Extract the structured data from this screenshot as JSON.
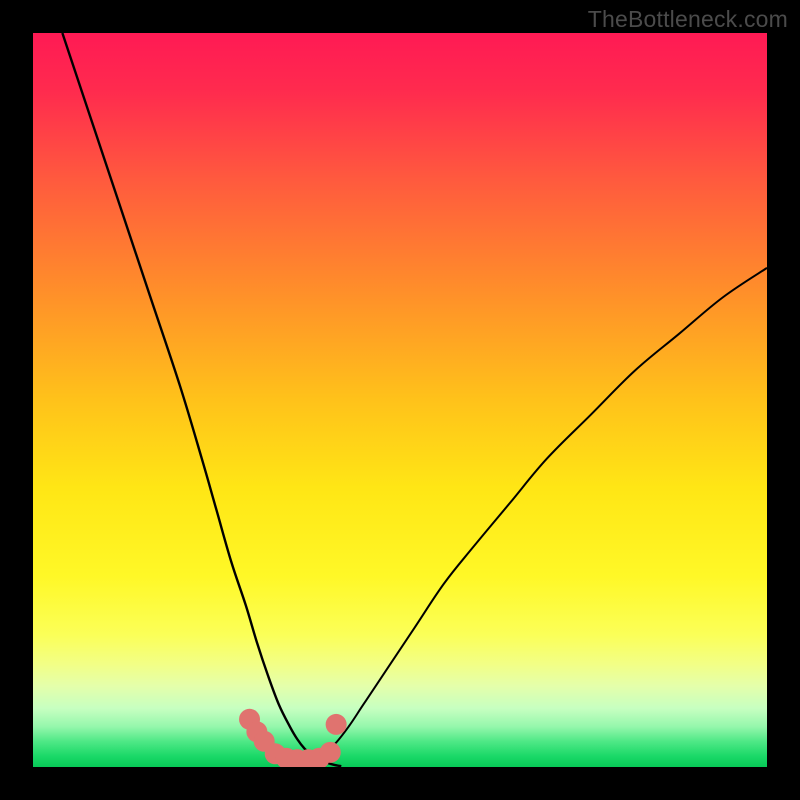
{
  "watermark": "TheBottleneck.com",
  "chart_data": {
    "type": "line",
    "title": "",
    "xlabel": "",
    "ylabel": "",
    "xlim": [
      0,
      100
    ],
    "ylim": [
      0,
      100
    ],
    "series": [
      {
        "name": "left-curve",
        "x": [
          4,
          8,
          12,
          16,
          20,
          23,
          25,
          27,
          29,
          30.5,
          32,
          33.5,
          35,
          36,
          37,
          38,
          39,
          40,
          41,
          42
        ],
        "y": [
          100,
          88,
          76,
          64,
          52,
          42,
          35,
          28,
          22,
          17,
          12.5,
          8.5,
          5.5,
          3.8,
          2.5,
          1.6,
          1.0,
          0.6,
          0.3,
          0.1
        ]
      },
      {
        "name": "right-curve",
        "x": [
          35,
          37,
          39,
          41,
          43,
          45,
          48,
          52,
          56,
          60,
          65,
          70,
          76,
          82,
          88,
          94,
          100
        ],
        "y": [
          0.1,
          0.5,
          1.4,
          3.0,
          5.5,
          8.5,
          13,
          19,
          25,
          30,
          36,
          42,
          48,
          54,
          59,
          64,
          68
        ]
      },
      {
        "name": "marker-cluster",
        "x": [
          29.5,
          30.5,
          31.5,
          33,
          34.5,
          36,
          37.5,
          39,
          40.5,
          41.3
        ],
        "y": [
          6.5,
          4.8,
          3.5,
          1.8,
          1.2,
          1.0,
          1.0,
          1.2,
          2.0,
          5.8
        ]
      }
    ],
    "gradient_stops": [
      {
        "pos": 0.0,
        "color": "#ff1a54"
      },
      {
        "pos": 0.08,
        "color": "#ff2b4e"
      },
      {
        "pos": 0.2,
        "color": "#ff5a3e"
      },
      {
        "pos": 0.35,
        "color": "#ff8e2a"
      },
      {
        "pos": 0.5,
        "color": "#ffc21a"
      },
      {
        "pos": 0.62,
        "color": "#ffe615"
      },
      {
        "pos": 0.74,
        "color": "#fff827"
      },
      {
        "pos": 0.82,
        "color": "#fbff58"
      },
      {
        "pos": 0.86,
        "color": "#f2ff86"
      },
      {
        "pos": 0.89,
        "color": "#e4ffab"
      },
      {
        "pos": 0.92,
        "color": "#c7ffc1"
      },
      {
        "pos": 0.945,
        "color": "#95f7ac"
      },
      {
        "pos": 0.965,
        "color": "#4fe886"
      },
      {
        "pos": 0.985,
        "color": "#1bd968"
      },
      {
        "pos": 1.0,
        "color": "#07c957"
      }
    ],
    "marker_color": "#e0736f",
    "curve_color": "#000000"
  }
}
